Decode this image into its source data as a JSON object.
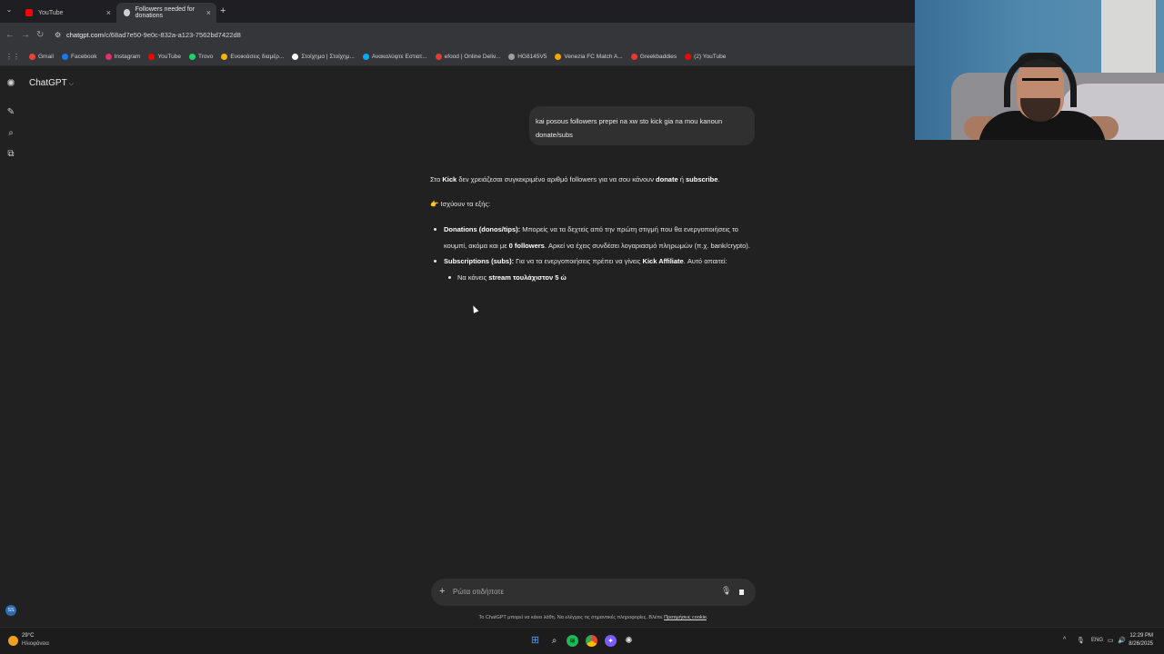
{
  "browser": {
    "tabs": [
      {
        "title": "YouTube",
        "active": false,
        "favicon_color": "#ff0000"
      },
      {
        "title": "Followers needed for donations",
        "active": true,
        "favicon_color": "#cfcfcf"
      }
    ],
    "new_tab_label": "+",
    "url": {
      "host": "chatgpt.com",
      "path": "/c/68ad7e50-9e0c-832a-a123-7562bd7422d8"
    },
    "bookmarks": [
      {
        "label": "Gmail",
        "color": "#ea4335"
      },
      {
        "label": "Facebook",
        "color": "#1877f2"
      },
      {
        "label": "Instagram",
        "color": "#e1306c"
      },
      {
        "label": "YouTube",
        "color": "#ff0000"
      },
      {
        "label": "Trovo",
        "color": "#19d66b"
      },
      {
        "label": "Ενοικιάσεις διαμέρ...",
        "color": "#f4b400"
      },
      {
        "label": "Στοίχημα | Στοίχημ...",
        "color": "#ffffff"
      },
      {
        "label": "Ανακαλύψτε Εστιατ...",
        "color": "#00aaff"
      },
      {
        "label": "efood | Online Deliv...",
        "color": "#e53935"
      },
      {
        "label": "HG8145V5",
        "color": "#9e9e9e"
      },
      {
        "label": "Venezia FC Match A...",
        "color": "#f7a600"
      },
      {
        "label": "Greekbaddies",
        "color": "#e53935"
      },
      {
        "label": "(2) YouTube",
        "color": "#ff0000"
      }
    ]
  },
  "app": {
    "model_title": "ChatGPT",
    "avatar_initials": "SS",
    "user_message": "kai posous followers prepei na xw sto kick gia na mou kanoun donate/subs",
    "answer": {
      "p1_a": "Στο ",
      "p1_b": "Kick",
      "p1_c": " δεν χρειάζεσαι συγκεκριμένο αριθμό followers για να σου κάνουν ",
      "p1_d": "donate",
      "p1_e": " ή ",
      "p1_f": "subscribe",
      "p1_g": ".",
      "p2": "👉 Ισχύουν τα εξής:",
      "li1_label": "Donations (donos/tips):",
      "li1_text_a": " Μπορείς να τα δεχτείς από την πρώτη στιγμή που θα ενεργοποιήσεις το κουμπί, ακόμα και με ",
      "li1_bold": "0 followers",
      "li1_text_b": ". Αρκεί να έχεις συνδέσει λογαριασμό πληρωμών (π.χ. bank/crypto).",
      "li2_label": "Subscriptions (subs):",
      "li2_text": " Για να τα ενεργοποιήσεις πρέπει να γίνεις ",
      "li2_bold": "Kick Affiliate",
      "li2_end": ". Αυτό απαιτεί:",
      "li3_text": "Να κάνεις ",
      "li3_bold": "stream τουλάχιστον 5 ώ"
    },
    "composer_placeholder": "Ρώτα οτιδήποτε",
    "disclaimer_text": "Το ChatGPT μπορεί να κάνει λάθη. Να ελέγχεις τις σημαντικές πληροφορίες. Βλέπε ",
    "disclaimer_link": "Προτιμήσεις cookie",
    "disclaimer_end": "."
  },
  "taskbar": {
    "weather_temp": "29°C",
    "weather_desc": "Ηλιοφάνεια",
    "lang": "ENG",
    "time": "12:29 PM",
    "date": "8/26/2025"
  }
}
